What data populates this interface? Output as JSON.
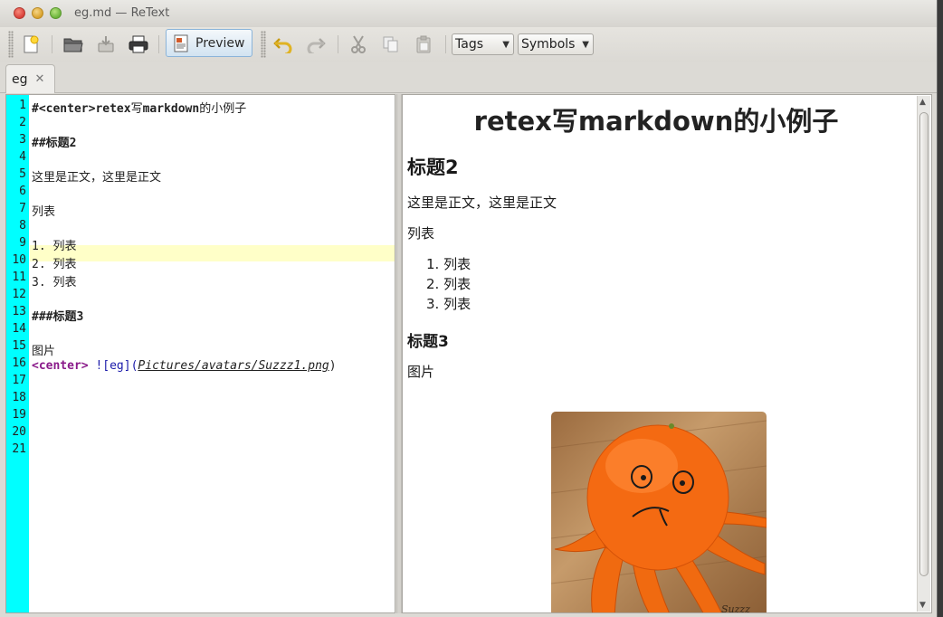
{
  "window": {
    "title": "eg.md — ReText"
  },
  "toolbar": {
    "preview_label": "Preview",
    "tags_label": "Tags",
    "symbols_label": "Symbols"
  },
  "tab": {
    "label": "eg",
    "close": "✕"
  },
  "editor": {
    "line_numbers": [
      "1",
      "2",
      "3",
      "4",
      "5",
      "6",
      "7",
      "8",
      "9",
      "10",
      "11",
      "12",
      "13",
      "14",
      "15",
      "16",
      "17",
      "18",
      "19",
      "20",
      "21"
    ],
    "lines": {
      "l1_prefix": "#<center>retex",
      "l1_mid": "写",
      "l1_bold2": "markdown",
      "l1_tail": "的小例子",
      "l3_hash": "##",
      "l3_text": "标题",
      "l3_num": "2",
      "l5": "这里是正文，这里是正文",
      "l7": "列表",
      "l9": "1. 列表",
      "l10": "2. 列表",
      "l11": "3. 列表",
      "l13_hash": "###",
      "l13_text": "标题",
      "l13_num": "3",
      "l15": "图片",
      "l16_tag": "<center>",
      "l16_bang": " ![",
      "l16_alt": "eg",
      "l16_mid": "](",
      "l16_url": "Pictures/avatars/Suzzz1.png",
      "l16_end": ")"
    }
  },
  "preview": {
    "h1": "retex写markdown的小例子",
    "h2": "标题2",
    "para": "这里是正文，这里是正文",
    "list_label": "列表",
    "list_items": [
      "1. 列表",
      "2. 列表",
      "3. 列表"
    ],
    "h3": "标题3",
    "image_label": "图片",
    "image_signature": "Suzzz"
  },
  "colors": {
    "gutter": "#00ffff",
    "current_line": "#ffffc8",
    "tag_purple": "#8a1a8a"
  }
}
